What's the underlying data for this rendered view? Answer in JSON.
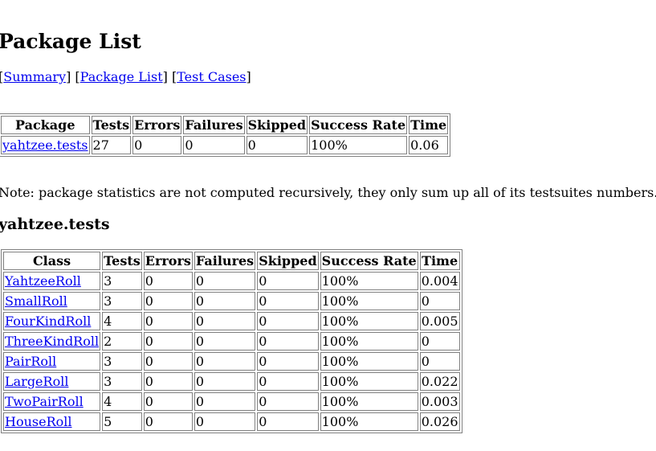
{
  "page": {
    "title": "Package List"
  },
  "nav": {
    "open1": "[",
    "summary": "Summary",
    "close1_open2": "] [",
    "package_list": "Package List",
    "close2_open3": "] [",
    "test_cases": "Test Cases",
    "close3": "]"
  },
  "package_table": {
    "headers": [
      "Package",
      "Tests",
      "Errors",
      "Failures",
      "Skipped",
      "Success Rate",
      "Time"
    ],
    "rows": [
      {
        "package": "yahtzee.tests",
        "tests": "27",
        "errors": "0",
        "failures": "0",
        "skipped": "0",
        "success_rate": "100%",
        "time": "0.06"
      }
    ]
  },
  "note": "Note: package statistics are not computed recursively, they only sum up all of its testsuites numbers.",
  "package_section": {
    "title": "yahtzee.tests"
  },
  "class_table": {
    "headers": [
      "Class",
      "Tests",
      "Errors",
      "Failures",
      "Skipped",
      "Success Rate",
      "Time"
    ],
    "rows": [
      {
        "class": "YahtzeeRoll",
        "tests": "3",
        "errors": "0",
        "failures": "0",
        "skipped": "0",
        "success_rate": "100%",
        "time": "0.004"
      },
      {
        "class": "SmallRoll",
        "tests": "3",
        "errors": "0",
        "failures": "0",
        "skipped": "0",
        "success_rate": "100%",
        "time": "0"
      },
      {
        "class": "FourKindRoll",
        "tests": "4",
        "errors": "0",
        "failures": "0",
        "skipped": "0",
        "success_rate": "100%",
        "time": "0.005"
      },
      {
        "class": "ThreeKindRoll",
        "tests": "2",
        "errors": "0",
        "failures": "0",
        "skipped": "0",
        "success_rate": "100%",
        "time": "0"
      },
      {
        "class": "PairRoll",
        "tests": "3",
        "errors": "0",
        "failures": "0",
        "skipped": "0",
        "success_rate": "100%",
        "time": "0"
      },
      {
        "class": "LargeRoll",
        "tests": "3",
        "errors": "0",
        "failures": "0",
        "skipped": "0",
        "success_rate": "100%",
        "time": "0.022"
      },
      {
        "class": "TwoPairRoll",
        "tests": "4",
        "errors": "0",
        "failures": "0",
        "skipped": "0",
        "success_rate": "100%",
        "time": "0.003"
      },
      {
        "class": "HouseRoll",
        "tests": "5",
        "errors": "0",
        "failures": "0",
        "skipped": "0",
        "success_rate": "100%",
        "time": "0.026"
      }
    ]
  },
  "colors": {
    "link": "#0000ee",
    "border": "#808080",
    "background": "#ffffff",
    "text": "#000000"
  }
}
